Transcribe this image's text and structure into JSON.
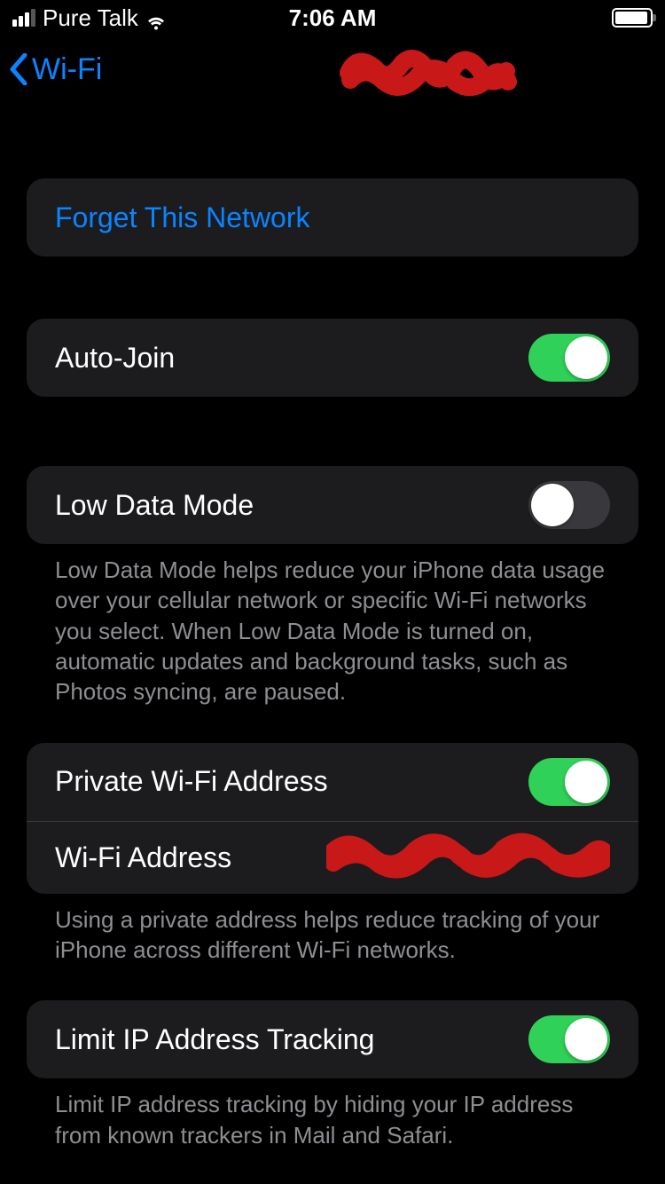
{
  "statusbar": {
    "carrier": "Pure Talk",
    "time": "7:06 AM"
  },
  "nav": {
    "back_label": "Wi-Fi"
  },
  "sections": {
    "forget": {
      "label": "Forget This Network"
    },
    "autojoin": {
      "label": "Auto-Join",
      "on": true
    },
    "lowdata": {
      "label": "Low Data Mode",
      "on": false,
      "footer": "Low Data Mode helps reduce your iPhone data usage over your cellular network or specific Wi-Fi networks you select. When Low Data Mode is turned on, automatic updates and background tasks, such as Photos syncing, are paused."
    },
    "private_addr": {
      "private_label": "Private Wi-Fi Address",
      "private_on": true,
      "wifi_addr_label": "Wi-Fi Address",
      "footer": "Using a private address helps reduce tracking of your iPhone across different Wi-Fi networks."
    },
    "limit_ip": {
      "label": "Limit IP Address Tracking",
      "on": true,
      "footer": "Limit IP address tracking by hiding your IP address from known trackers in Mail and Safari."
    }
  }
}
